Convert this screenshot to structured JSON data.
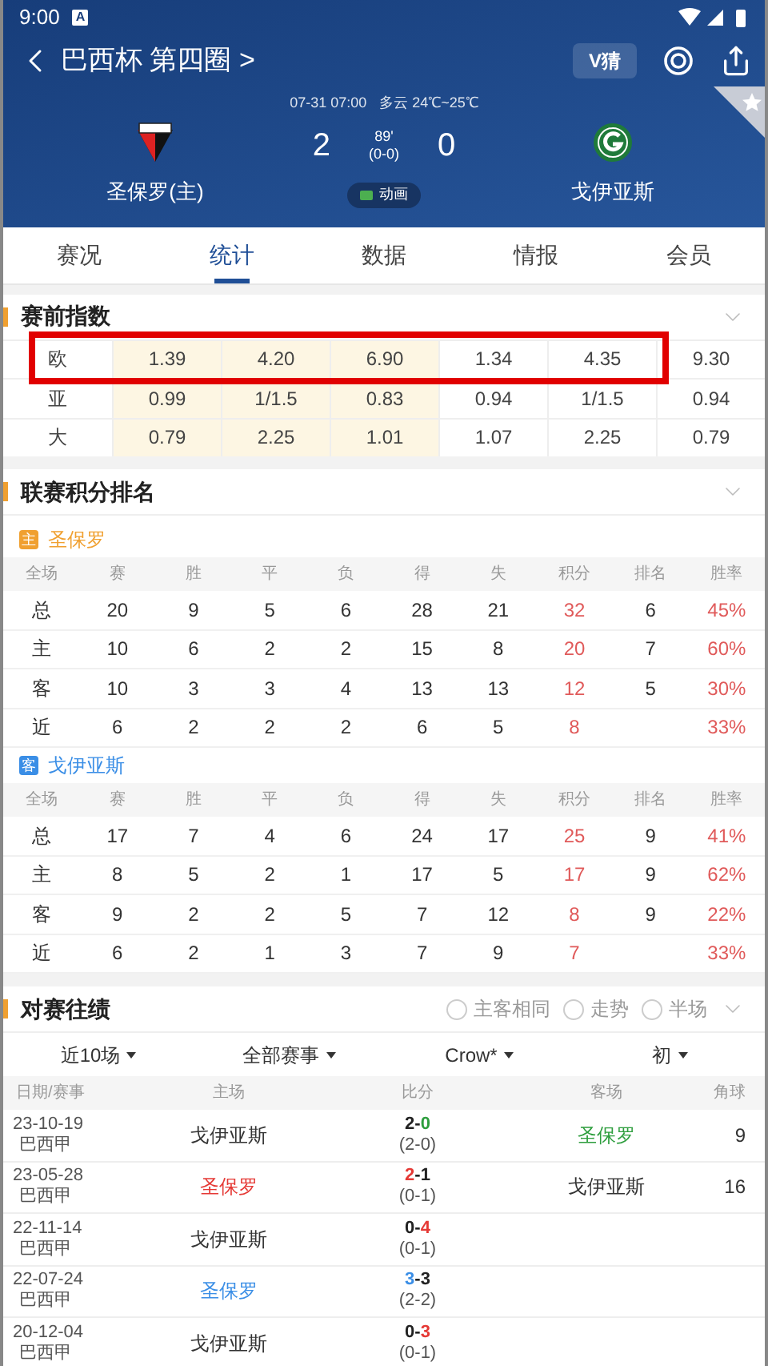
{
  "status_bar": {
    "time": "9:00",
    "badge": "A"
  },
  "header": {
    "title": "巴西杯 第四圈 >",
    "guess_button": "V猜",
    "datetime": "07-31 07:00",
    "weather": "多云 24℃~25℃",
    "home": {
      "name": "圣保罗(主)"
    },
    "away": {
      "name": "戈伊亚斯"
    },
    "home_score": "2",
    "away_score": "0",
    "minute": "89'",
    "half_score": "(0-0)",
    "animation_button": "动画",
    "favorite": false
  },
  "tabs": [
    {
      "label": "赛况",
      "selected": false
    },
    {
      "label": "统计",
      "selected": true
    },
    {
      "label": "数据",
      "selected": false
    },
    {
      "label": "情报",
      "selected": false
    },
    {
      "label": "会员",
      "selected": false
    }
  ],
  "odds": {
    "title": "赛前指数",
    "expanded": true,
    "rows": [
      {
        "type": "欧",
        "highlighted": true,
        "values": [
          "1.39",
          "4.20",
          "6.90",
          "1.34",
          "4.35",
          "9.30"
        ]
      },
      {
        "type": "亚",
        "highlighted": false,
        "values": [
          "0.99",
          "1/1.5",
          "0.83",
          "0.94",
          "1/1.5",
          "0.94"
        ]
      },
      {
        "type": "大",
        "highlighted": false,
        "values": [
          "0.79",
          "2.25",
          "1.01",
          "1.07",
          "2.25",
          "0.79"
        ]
      }
    ]
  },
  "standings": {
    "title": "联赛积分排名",
    "expanded": true,
    "teams": [
      {
        "badge": "主",
        "name": "圣保罗",
        "color": "#f0a030",
        "columns": [
          "全场",
          "赛",
          "胜",
          "平",
          "负",
          "得",
          "失",
          "积分",
          "排名",
          "胜率"
        ],
        "rows": [
          [
            "总",
            "20",
            "9",
            "5",
            "6",
            "28",
            "21",
            "32",
            "6",
            "45%"
          ],
          [
            "主",
            "10",
            "6",
            "2",
            "2",
            "15",
            "8",
            "20",
            "7",
            "60%"
          ],
          [
            "客",
            "10",
            "3",
            "3",
            "4",
            "13",
            "13",
            "12",
            "5",
            "30%"
          ],
          [
            "近",
            "6",
            "2",
            "2",
            "2",
            "6",
            "5",
            "8",
            "",
            "33%"
          ]
        ]
      },
      {
        "badge": "客",
        "name": "戈伊亚斯",
        "color": "#3a8ee6",
        "columns": [
          "全场",
          "赛",
          "胜",
          "平",
          "负",
          "得",
          "失",
          "积分",
          "排名",
          "胜率"
        ],
        "rows": [
          [
            "总",
            "17",
            "7",
            "4",
            "6",
            "24",
            "17",
            "25",
            "9",
            "41%"
          ],
          [
            "主",
            "8",
            "5",
            "2",
            "1",
            "17",
            "5",
            "17",
            "9",
            "62%"
          ],
          [
            "客",
            "9",
            "2",
            "2",
            "5",
            "7",
            "12",
            "8",
            "9",
            "22%"
          ],
          [
            "近",
            "6",
            "2",
            "1",
            "3",
            "7",
            "9",
            "7",
            "",
            "33%"
          ]
        ]
      }
    ]
  },
  "h2h": {
    "title": "对赛往绩",
    "expanded": true,
    "options": [
      {
        "label": "主客相同",
        "checked": false
      },
      {
        "label": "走势",
        "checked": false
      },
      {
        "label": "半场",
        "checked": false
      }
    ],
    "filters": [
      "近10场",
      "全部赛事",
      "Crow*",
      "初"
    ],
    "columns": [
      "日期/赛事",
      "主场",
      "比分",
      "客场",
      "角球"
    ],
    "rows": [
      {
        "date": "23-10-19",
        "league": "巴西甲",
        "home": {
          "name": "戈伊亚斯"
        },
        "score": [
          {
            "text": "2"
          },
          {
            "text": "-"
          },
          {
            "text": "0",
            "color": "#2e9e3e"
          }
        ],
        "half": "(2-0)",
        "away": {
          "name": "圣保罗",
          "color": "#2e9e3e"
        },
        "corners": "9"
      },
      {
        "date": "23-05-28",
        "league": "巴西甲",
        "home": {
          "name": "圣保罗",
          "color": "#e53935"
        },
        "score": [
          {
            "text": "2",
            "color": "#e53935"
          },
          {
            "text": "-"
          },
          {
            "text": "1"
          }
        ],
        "half": "(0-1)",
        "away": {
          "name": "戈伊亚斯"
        },
        "corners": "16"
      },
      {
        "date": "22-11-14",
        "league": "巴西甲",
        "home": {
          "name": "戈伊亚斯"
        },
        "score": [
          {
            "text": "0"
          },
          {
            "text": "-"
          },
          {
            "text": "4",
            "color": "#e53935"
          }
        ],
        "half": "(0-1)"
      },
      {
        "date": "22-07-24",
        "league": "巴西甲",
        "home": {
          "name": "圣保罗",
          "color": "#3a8ee6"
        },
        "score": [
          {
            "text": "3",
            "color": "#3a8ee6"
          },
          {
            "text": "-"
          },
          {
            "text": "3"
          }
        ],
        "half": "(2-2)"
      },
      {
        "date": "20-12-04",
        "league": "巴西甲",
        "home": {
          "name": "戈伊亚斯"
        },
        "score": [
          {
            "text": "0"
          },
          {
            "text": "-"
          },
          {
            "text": "3",
            "color": "#e53935"
          }
        ],
        "half": "(0-1)"
      }
    ]
  }
}
